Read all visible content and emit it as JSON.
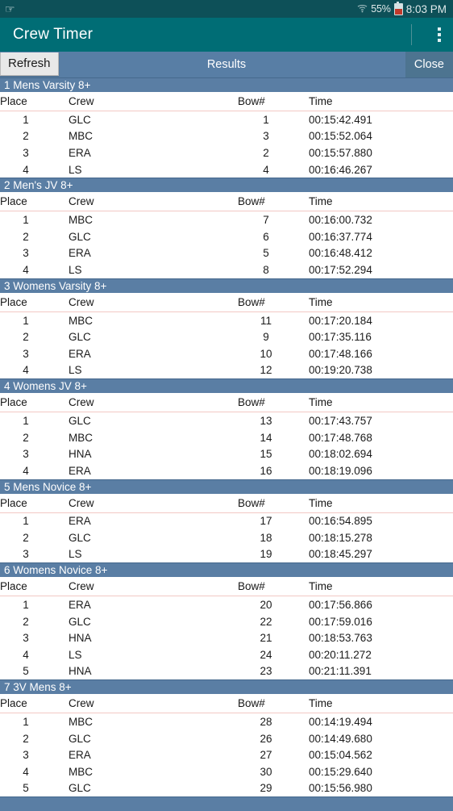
{
  "statusbar": {
    "usb_icon": "usb-icon",
    "wifi_icon": "wifi-icon",
    "battery_percent": "55%",
    "battery_icon": "battery-charging-icon",
    "time": "8:03 PM"
  },
  "appbar": {
    "title": "Crew Timer",
    "overflow_icon": "overflow-menu-icon"
  },
  "toolbar": {
    "refresh_label": "Refresh",
    "title": "Results",
    "close_label": "Close"
  },
  "columns": {
    "place": "Place",
    "crew": "Crew",
    "bow": "Bow#",
    "time": "Time"
  },
  "colors": {
    "statusbar_bg": "#0d5058",
    "appbar_bg": "#006d75",
    "toolbar_bg": "#587ea5",
    "race_header_bg": "#5a7ea4",
    "close_bg": "#4d7490",
    "separator": "#f2c8c4"
  },
  "races": [
    {
      "title": "1 Mens Varsity 8+",
      "rows": [
        {
          "place": "1",
          "crew": "GLC",
          "bow": "1",
          "time": "00:15:42.491"
        },
        {
          "place": "2",
          "crew": "MBC",
          "bow": "3",
          "time": "00:15:52.064"
        },
        {
          "place": "3",
          "crew": "ERA",
          "bow": "2",
          "time": "00:15:57.880"
        },
        {
          "place": "4",
          "crew": "LS",
          "bow": "4",
          "time": "00:16:46.267"
        }
      ]
    },
    {
      "title": "2 Men's JV 8+",
      "rows": [
        {
          "place": "1",
          "crew": "MBC",
          "bow": "7",
          "time": "00:16:00.732"
        },
        {
          "place": "2",
          "crew": "GLC",
          "bow": "6",
          "time": "00:16:37.774"
        },
        {
          "place": "3",
          "crew": "ERA",
          "bow": "5",
          "time": "00:16:48.412"
        },
        {
          "place": "4",
          "crew": "LS",
          "bow": "8",
          "time": "00:17:52.294"
        }
      ]
    },
    {
      "title": "3 Womens Varsity 8+",
      "rows": [
        {
          "place": "1",
          "crew": "MBC",
          "bow": "11",
          "time": "00:17:20.184"
        },
        {
          "place": "2",
          "crew": "GLC",
          "bow": "9",
          "time": "00:17:35.116"
        },
        {
          "place": "3",
          "crew": "ERA",
          "bow": "10",
          "time": "00:17:48.166"
        },
        {
          "place": "4",
          "crew": "LS",
          "bow": "12",
          "time": "00:19:20.738"
        }
      ]
    },
    {
      "title": "4 Womens JV 8+",
      "rows": [
        {
          "place": "1",
          "crew": "GLC",
          "bow": "13",
          "time": "00:17:43.757"
        },
        {
          "place": "2",
          "crew": "MBC",
          "bow": "14",
          "time": "00:17:48.768"
        },
        {
          "place": "3",
          "crew": "HNA",
          "bow": "15",
          "time": "00:18:02.694"
        },
        {
          "place": "4",
          "crew": "ERA",
          "bow": "16",
          "time": "00:18:19.096"
        }
      ]
    },
    {
      "title": "5 Mens Novice 8+",
      "rows": [
        {
          "place": "1",
          "crew": "ERA",
          "bow": "17",
          "time": "00:16:54.895"
        },
        {
          "place": "2",
          "crew": "GLC",
          "bow": "18",
          "time": "00:18:15.278"
        },
        {
          "place": "3",
          "crew": "LS",
          "bow": "19",
          "time": "00:18:45.297"
        }
      ]
    },
    {
      "title": "6 Womens Novice 8+",
      "rows": [
        {
          "place": "1",
          "crew": "ERA",
          "bow": "20",
          "time": "00:17:56.866"
        },
        {
          "place": "2",
          "crew": "GLC",
          "bow": "22",
          "time": "00:17:59.016"
        },
        {
          "place": "3",
          "crew": "HNA",
          "bow": "21",
          "time": "00:18:53.763"
        },
        {
          "place": "4",
          "crew": "LS",
          "bow": "24",
          "time": "00:20:11.272"
        },
        {
          "place": "5",
          "crew": "HNA",
          "bow": "23",
          "time": "00:21:11.391"
        }
      ]
    },
    {
      "title": "7 3V Mens 8+",
      "rows": [
        {
          "place": "1",
          "crew": "MBC",
          "bow": "28",
          "time": "00:14:19.494"
        },
        {
          "place": "2",
          "crew": "GLC",
          "bow": "26",
          "time": "00:14:49.680"
        },
        {
          "place": "3",
          "crew": "ERA",
          "bow": "27",
          "time": "00:15:04.562"
        },
        {
          "place": "4",
          "crew": "MBC",
          "bow": "30",
          "time": "00:15:29.640"
        },
        {
          "place": "5",
          "crew": "GLC",
          "bow": "29",
          "time": "00:15:56.980"
        }
      ]
    }
  ]
}
